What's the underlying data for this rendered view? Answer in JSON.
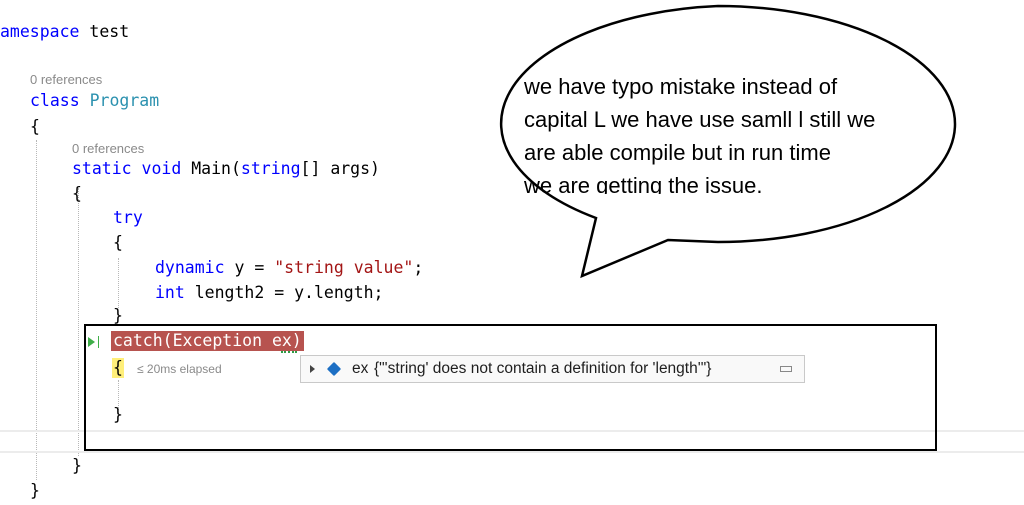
{
  "editor": {
    "namespace_kw": "amespace",
    "namespace_name": "test",
    "refs_class": "0 references",
    "class_kw": "class",
    "class_name": "Program",
    "brace_open": "{",
    "brace_close": "}",
    "refs_main": "0 references",
    "static_kw": "static",
    "void_kw": "void",
    "method_name": "Main(",
    "string_kw": "string",
    "params_rest": "[] args)",
    "try_kw": "try",
    "dynamic_kw": "dynamic",
    "decl_y": "y = ",
    "string_literal": "\"string value\"",
    "semicolon": ";",
    "int_kw": "int",
    "decl_length": "length2 = y.length;",
    "catch_text": "catch(Exception ex)",
    "elapsed": "≤ 20ms elapsed"
  },
  "datatip": {
    "var_name": "ex",
    "value": "{\"'string' does not contain a definition for 'length'\"}"
  },
  "callout": {
    "line1": "we have typo mistake instead of",
    "line2": "capital L we have use samll l still we",
    "line3": "are able compile but in run time",
    "line4": "we are getting the issue."
  },
  "colors": {
    "keyword": "#0000ff",
    "type": "#2b91af",
    "string": "#a31515",
    "exception_highlight": "#b7534f",
    "current_brace": "#ffef7a"
  }
}
